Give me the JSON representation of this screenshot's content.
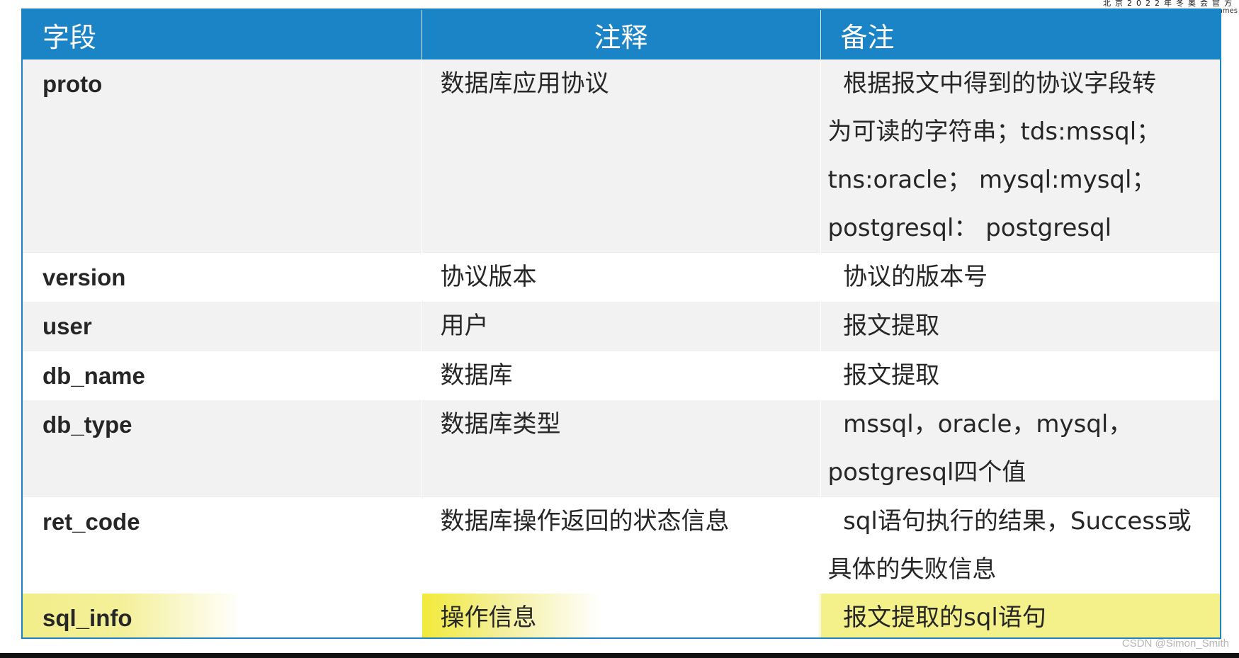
{
  "watermark": {
    "line1": "北京2022年冬奥会官方",
    "line2": "ames"
  },
  "table": {
    "headers": [
      "字段",
      "注释",
      "备注"
    ],
    "rows": [
      {
        "field": "proto",
        "note": "数据库应用协议",
        "remark_lines": [
          "  根据报文中得到的协议字段转",
          "为可读的字符串；tds:mssql；",
          "tns:oracle； mysql:mysql；",
          "postgresql： postgresql"
        ]
      },
      {
        "field": "version",
        "note": "协议版本",
        "remark_lines": [
          "  协议的版本号"
        ]
      },
      {
        "field": "user",
        "note": "用户",
        "remark_lines": [
          "  报文提取"
        ]
      },
      {
        "field": "db_name",
        "note": "数据库",
        "remark_lines": [
          "  报文提取"
        ]
      },
      {
        "field": "db_type",
        "note": "数据库类型",
        "remark_lines": [
          "  mssql，oracle，mysql，",
          "postgresql四个值"
        ]
      },
      {
        "field": "ret_code",
        "note": "数据库操作返回的状态信息",
        "remark_lines": [
          "  sql语句执行的结果，Success或",
          "具体的失败信息"
        ]
      },
      {
        "field": "sql_info",
        "note": "操作信息",
        "remark_lines": [
          "  报文提取的sql语句"
        ]
      }
    ]
  },
  "credit": "CSDN @Simon_Smith",
  "colors": {
    "header_bg": "#1b84c6",
    "alt_row_bg": "#f2f2f2",
    "highlight": "#f4f08a"
  }
}
